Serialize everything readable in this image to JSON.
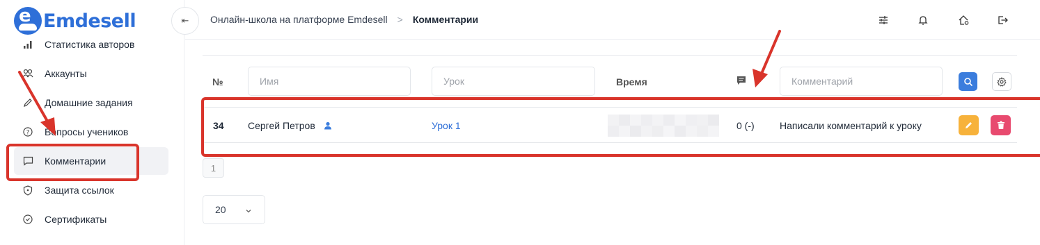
{
  "app": {
    "logo_letter": "e",
    "logo_text": "Emdesell"
  },
  "sidebar": {
    "items": [
      {
        "label": "Статистика авторов",
        "icon": "bar-chart-icon"
      },
      {
        "label": "Аккаунты",
        "icon": "users-icon"
      },
      {
        "label": "Домашние задания",
        "icon": "pencil-icon"
      },
      {
        "label": "Вопросы учеников",
        "icon": "question-circle-icon"
      },
      {
        "label": "Комментарии",
        "icon": "comment-icon",
        "active": true
      },
      {
        "label": "Защита ссылок",
        "icon": "shield-icon"
      },
      {
        "label": "Сертификаты",
        "icon": "check-circle-icon"
      }
    ]
  },
  "header": {
    "collapse_glyph": "⇤",
    "breadcrumb": [
      "Онлайн-школа на платформе Emdesell",
      "Комментарии"
    ],
    "breadcrumb_separator": ">",
    "icons": [
      "sliders-icon",
      "bell-icon",
      "home-settings-icon",
      "logout-icon"
    ]
  },
  "table": {
    "headers": {
      "id": "№",
      "time": "Время"
    },
    "filters": {
      "name_placeholder": "Имя",
      "lesson_placeholder": "Урок",
      "comment_placeholder": "Комментарий"
    },
    "rows": [
      {
        "id": "34",
        "name": "Сергей Петров",
        "lesson": "Урок 1",
        "time": "",
        "replies": "0 (-)",
        "comment": "Написали комментарий к уроку"
      }
    ]
  },
  "pagination": {
    "current_page": "1",
    "per_page": "20"
  },
  "colors": {
    "brand": "#2e6fd8",
    "annotation": "#d9342b",
    "edit": "#f7b23b",
    "delete": "#e84a6f",
    "search": "#3b7ddd"
  }
}
